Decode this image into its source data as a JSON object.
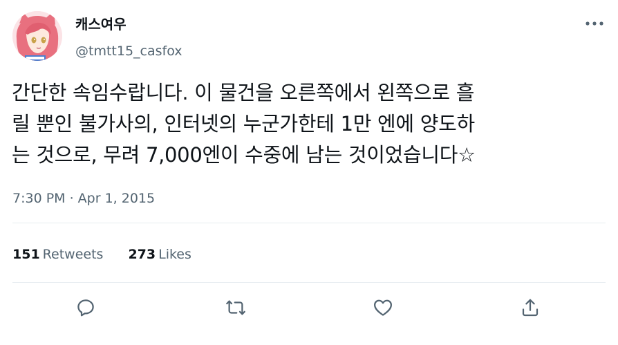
{
  "author": {
    "display_name": "캐스여우",
    "handle": "@tmtt15_casfox",
    "avatar": "avatar-pink-hair-character"
  },
  "tweet": {
    "text": "간단한 속임수랍니다. 이 물건을 오른쪽에서 왼쪽으로 흘\n릴 뿐인 불가사의, 인터넷의 누군가한테 1만 엔에 양도하\n는 것으로, 무려 7,000엔이 수중에 남는 것이었습니다☆",
    "timestamp": "7:30 PM · Apr 1, 2015"
  },
  "stats": {
    "retweets_count": "151",
    "retweets_label": "Retweets",
    "likes_count": "273",
    "likes_label": "Likes"
  },
  "actions": {
    "reply_icon": "reply-icon",
    "retweet_icon": "retweet-icon",
    "like_icon": "like-icon",
    "share_icon": "share-icon"
  },
  "colors": {
    "text_primary": "#0f1419",
    "text_secondary": "#536471",
    "divider": "#e6ecf0"
  }
}
